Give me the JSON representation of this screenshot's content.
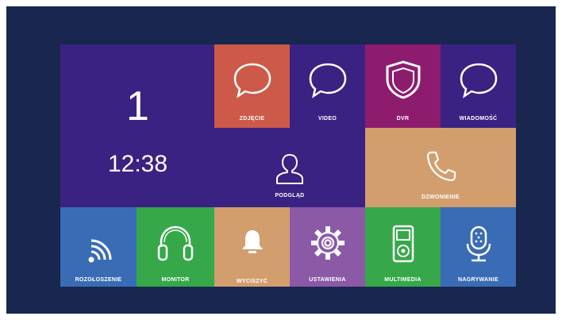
{
  "colors": {
    "frame": "#182650",
    "blue_tile": "#3a2283",
    "red_tile": "#cd5a48",
    "magenta_tile": "#8e1c6e",
    "tan_tile": "#d39e6d",
    "steel_tile": "#3a6cb5",
    "green_tile": "#36a84a",
    "violet_tile": "#8c59a6",
    "white": "#ffffff"
  },
  "clock": {
    "day": "1",
    "time": "12:38"
  },
  "top_row": [
    {
      "label": "ZDJĘCIE",
      "icon": "speech-bubble-icon"
    },
    {
      "label": "VIDEO",
      "icon": "speech-bubble-icon"
    },
    {
      "label": "DVR",
      "icon": "shield-icon"
    },
    {
      "label": "WIADOMOŚĆ",
      "icon": "speech-bubble-icon"
    }
  ],
  "middle_row": [
    {
      "label": "PODGLĄD",
      "icon": "person-icon"
    },
    {
      "label": "DZWONIENIE",
      "icon": "phone-icon"
    }
  ],
  "bottom_row": [
    {
      "label": "ROZGŁOSZENIE",
      "icon": "broadcast-icon"
    },
    {
      "label": "MONITOR",
      "icon": "headphones-icon"
    },
    {
      "label": "WYCISZYĆ",
      "icon": "bell-icon"
    },
    {
      "label": "USTAWIENIA",
      "icon": "gear-icon"
    },
    {
      "label": "MULTIMEDIA",
      "icon": "media-player-icon"
    },
    {
      "label": "NAGRYWANIE",
      "icon": "microphone-icon"
    }
  ]
}
